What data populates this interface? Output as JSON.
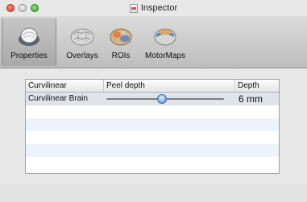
{
  "window": {
    "title": "Inspector",
    "colors": {
      "close": "#d63a2a",
      "minimize": "#bdbdbd",
      "zoom": "#3aa42c"
    }
  },
  "toolbar": {
    "items": [
      {
        "label": "Properties",
        "icon": "properties-icon",
        "selected": true
      },
      {
        "label": "Overlays",
        "icon": "overlays-icon",
        "selected": false
      },
      {
        "label": "ROIs",
        "icon": "rois-icon",
        "selected": false
      },
      {
        "label": "MotorMaps",
        "icon": "motormaps-icon",
        "selected": false
      }
    ]
  },
  "table": {
    "headers": {
      "col1": "Curvilinear",
      "col2": "Peel depth",
      "col3": "Depth"
    },
    "rows": [
      {
        "name": "Curvilinear Brain",
        "slider_fraction": 0.47,
        "depth": "6 mm"
      }
    ],
    "colors": {
      "selected_row": "#dfe4ea",
      "alt_row": "#edf3fb",
      "slider_knob": "#7fb2e8"
    }
  }
}
